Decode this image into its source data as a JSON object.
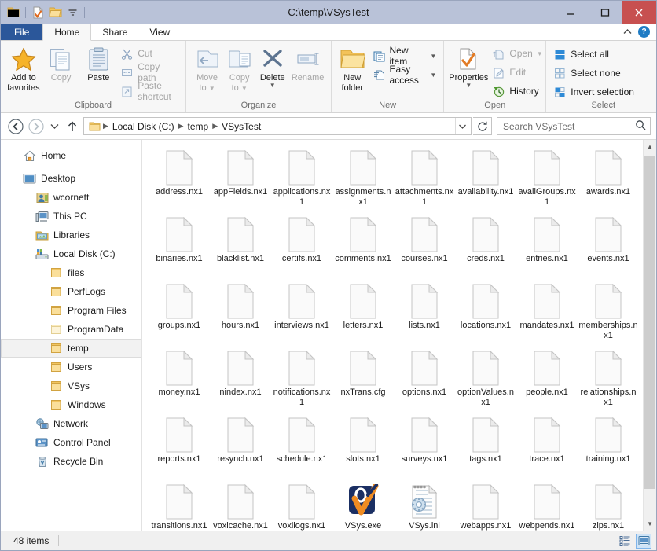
{
  "window": {
    "title": "C:\\temp\\VSysTest",
    "quick_access": [
      {
        "name": "folder-icon",
        "label": "Properties"
      },
      {
        "name": "new-folder-icon",
        "label": "New folder"
      },
      {
        "name": "undo-icon",
        "label": "Customize"
      }
    ],
    "controls": {
      "minimize": "minimize-icon",
      "maximize": "maximize-icon",
      "close": "close-icon"
    }
  },
  "tabs": [
    {
      "label": "File",
      "type": "file"
    },
    {
      "label": "Home",
      "type": "active"
    },
    {
      "label": "Share",
      "type": "normal"
    },
    {
      "label": "View",
      "type": "normal"
    }
  ],
  "tabstrip_right": {
    "collapse_label": "^",
    "help_label": "?"
  },
  "ribbon": {
    "groups": [
      {
        "title": "Clipboard",
        "big": [
          {
            "label_1": "Add to",
            "label_2": "favorites",
            "icon": "star-icon",
            "dim": false
          },
          {
            "label_1": "Copy",
            "label_2": "",
            "icon": "copy-icon",
            "dim": true
          },
          {
            "label_1": "Paste",
            "label_2": "",
            "icon": "paste-icon",
            "dim": false
          }
        ],
        "small": [
          {
            "label": "Cut",
            "icon": "scissors-icon",
            "dim": true
          },
          {
            "label": "Copy path",
            "icon": "copy-path-icon",
            "dim": true
          },
          {
            "label": "Paste shortcut",
            "icon": "paste-shortcut-icon",
            "dim": true
          }
        ]
      },
      {
        "title": "Organize",
        "big": [
          {
            "label_1": "Move",
            "label_2": "to",
            "icon": "move-to-icon",
            "dim": true,
            "caret": true
          },
          {
            "label_1": "Copy",
            "label_2": "to",
            "icon": "copy-to-icon",
            "dim": true,
            "caret": true
          },
          {
            "label_1": "Delete",
            "label_2": "",
            "icon": "delete-icon",
            "dim": false,
            "caret": true
          },
          {
            "label_1": "Rename",
            "label_2": "",
            "icon": "rename-icon",
            "dim": true
          }
        ],
        "small": []
      },
      {
        "title": "New",
        "big": [
          {
            "label_1": "New",
            "label_2": "folder",
            "icon": "new-folder-icon",
            "dim": false
          }
        ],
        "small": [
          {
            "label": "New item",
            "icon": "new-item-icon",
            "dim": false,
            "caret": true
          },
          {
            "label": "Easy access",
            "icon": "easy-access-icon",
            "dim": false,
            "caret": true
          }
        ]
      },
      {
        "title": "Open",
        "big": [
          {
            "label_1": "Properties",
            "label_2": "",
            "icon": "properties-icon",
            "dim": false,
            "caret": true
          }
        ],
        "small": [
          {
            "label": "Open",
            "icon": "open-icon",
            "dim": true,
            "caret": true
          },
          {
            "label": "Edit",
            "icon": "edit-icon",
            "dim": true
          },
          {
            "label": "History",
            "icon": "history-icon",
            "dim": false
          }
        ]
      },
      {
        "title": "Select",
        "big": [],
        "small": [
          {
            "label": "Select all",
            "icon": "select-all-icon",
            "dim": false
          },
          {
            "label": "Select none",
            "icon": "select-none-icon",
            "dim": false
          },
          {
            "label": "Invert selection",
            "icon": "invert-selection-icon",
            "dim": false
          }
        ]
      }
    ]
  },
  "address": {
    "back": "back-icon",
    "forward": "forward-icon",
    "recent": "recent-locations-icon",
    "up": "up-icon",
    "folder_icon": "folder-icon",
    "crumbs": [
      "Local Disk (C:)",
      "temp",
      "VSysTest"
    ],
    "dropdown": "chevron-down-icon",
    "refresh": "refresh-icon",
    "search_placeholder": "Search VSysTest",
    "search_value": "",
    "search_icon": "search-icon"
  },
  "sidebar": {
    "items": [
      {
        "label": "Home",
        "icon": "home-icon",
        "indent": 0,
        "selected": false
      },
      {
        "label": "Desktop",
        "icon": "desktop-icon",
        "indent": 0,
        "selected": false
      },
      {
        "label": "wcornett",
        "icon": "user-icon",
        "indent": 1,
        "selected": false
      },
      {
        "label": "This PC",
        "icon": "this-pc-icon",
        "indent": 1,
        "selected": false
      },
      {
        "label": "Libraries",
        "icon": "libraries-icon",
        "indent": 1,
        "selected": false
      },
      {
        "label": "Local Disk (C:)",
        "icon": "drive-icon",
        "indent": 1,
        "selected": false
      },
      {
        "label": "files",
        "icon": "folder-icon",
        "indent": 2,
        "selected": false
      },
      {
        "label": "PerfLogs",
        "icon": "folder-icon",
        "indent": 2,
        "selected": false
      },
      {
        "label": "Program Files",
        "icon": "folder-icon",
        "indent": 2,
        "selected": false
      },
      {
        "label": "ProgramData",
        "icon": "folder-pale-icon",
        "indent": 2,
        "selected": false
      },
      {
        "label": "temp",
        "icon": "folder-icon",
        "indent": 2,
        "selected": true
      },
      {
        "label": "Users",
        "icon": "folder-icon",
        "indent": 2,
        "selected": false
      },
      {
        "label": "VSys",
        "icon": "folder-icon",
        "indent": 2,
        "selected": false
      },
      {
        "label": "Windows",
        "icon": "folder-icon",
        "indent": 2,
        "selected": false
      },
      {
        "label": "Network",
        "icon": "network-icon",
        "indent": 1,
        "selected": false
      },
      {
        "label": "Control Panel",
        "icon": "control-panel-icon",
        "indent": 1,
        "selected": false
      },
      {
        "label": "Recycle Bin",
        "icon": "recycle-bin-icon",
        "indent": 1,
        "selected": false
      }
    ]
  },
  "files": [
    {
      "name": "address.nx1",
      "icon": "blank-file-icon"
    },
    {
      "name": "appFields.nx1",
      "icon": "blank-file-icon"
    },
    {
      "name": "applications.nx1",
      "icon": "blank-file-icon"
    },
    {
      "name": "assignments.nx1",
      "icon": "blank-file-icon"
    },
    {
      "name": "attachments.nx1",
      "icon": "blank-file-icon"
    },
    {
      "name": "availability.nx1",
      "icon": "blank-file-icon"
    },
    {
      "name": "availGroups.nx1",
      "icon": "blank-file-icon"
    },
    {
      "name": "awards.nx1",
      "icon": "blank-file-icon"
    },
    {
      "name": "binaries.nx1",
      "icon": "blank-file-icon"
    },
    {
      "name": "blacklist.nx1",
      "icon": "blank-file-icon"
    },
    {
      "name": "certifs.nx1",
      "icon": "blank-file-icon"
    },
    {
      "name": "comments.nx1",
      "icon": "blank-file-icon"
    },
    {
      "name": "courses.nx1",
      "icon": "blank-file-icon"
    },
    {
      "name": "creds.nx1",
      "icon": "blank-file-icon"
    },
    {
      "name": "entries.nx1",
      "icon": "blank-file-icon"
    },
    {
      "name": "events.nx1",
      "icon": "blank-file-icon"
    },
    {
      "name": "groups.nx1",
      "icon": "blank-file-icon"
    },
    {
      "name": "hours.nx1",
      "icon": "blank-file-icon"
    },
    {
      "name": "interviews.nx1",
      "icon": "blank-file-icon"
    },
    {
      "name": "letters.nx1",
      "icon": "blank-file-icon"
    },
    {
      "name": "lists.nx1",
      "icon": "blank-file-icon"
    },
    {
      "name": "locations.nx1",
      "icon": "blank-file-icon"
    },
    {
      "name": "mandates.nx1",
      "icon": "blank-file-icon"
    },
    {
      "name": "memberships.nx1",
      "icon": "blank-file-icon"
    },
    {
      "name": "money.nx1",
      "icon": "blank-file-icon"
    },
    {
      "name": "nindex.nx1",
      "icon": "blank-file-icon"
    },
    {
      "name": "notifications.nx1",
      "icon": "blank-file-icon"
    },
    {
      "name": "nxTrans.cfg",
      "icon": "blank-file-icon"
    },
    {
      "name": "options.nx1",
      "icon": "blank-file-icon"
    },
    {
      "name": "optionValues.nx1",
      "icon": "blank-file-icon"
    },
    {
      "name": "people.nx1",
      "icon": "blank-file-icon"
    },
    {
      "name": "relationships.nx1",
      "icon": "blank-file-icon"
    },
    {
      "name": "reports.nx1",
      "icon": "blank-file-icon"
    },
    {
      "name": "resynch.nx1",
      "icon": "blank-file-icon"
    },
    {
      "name": "schedule.nx1",
      "icon": "blank-file-icon"
    },
    {
      "name": "slots.nx1",
      "icon": "blank-file-icon"
    },
    {
      "name": "surveys.nx1",
      "icon": "blank-file-icon"
    },
    {
      "name": "tags.nx1",
      "icon": "blank-file-icon"
    },
    {
      "name": "trace.nx1",
      "icon": "blank-file-icon"
    },
    {
      "name": "training.nx1",
      "icon": "blank-file-icon"
    },
    {
      "name": "transitions.nx1",
      "icon": "blank-file-icon"
    },
    {
      "name": "voxicache.nx1",
      "icon": "blank-file-icon"
    },
    {
      "name": "voxilogs.nx1",
      "icon": "blank-file-icon"
    },
    {
      "name": "VSys.exe",
      "icon": "vsys-app-icon"
    },
    {
      "name": "VSys.ini",
      "icon": "ini-file-icon"
    },
    {
      "name": "webapps.nx1",
      "icon": "blank-file-icon"
    },
    {
      "name": "webpends.nx1",
      "icon": "blank-file-icon"
    },
    {
      "name": "zips.nx1",
      "icon": "blank-file-icon"
    }
  ],
  "statusbar": {
    "item_count": "48 items",
    "views": [
      {
        "name": "details-view-button",
        "label": "Details view",
        "active": false
      },
      {
        "name": "large-icons-view-button",
        "label": "Large icons view",
        "active": true
      }
    ]
  },
  "colors": {
    "titlebar": "#b9c2d8",
    "file_tab": "#2b579a",
    "close_button": "#c75050",
    "folder": "#f5c964",
    "accent_blue": "#1e7bc4",
    "vsys_navy": "#1b2f63",
    "vsys_orange": "#ef8c22"
  }
}
